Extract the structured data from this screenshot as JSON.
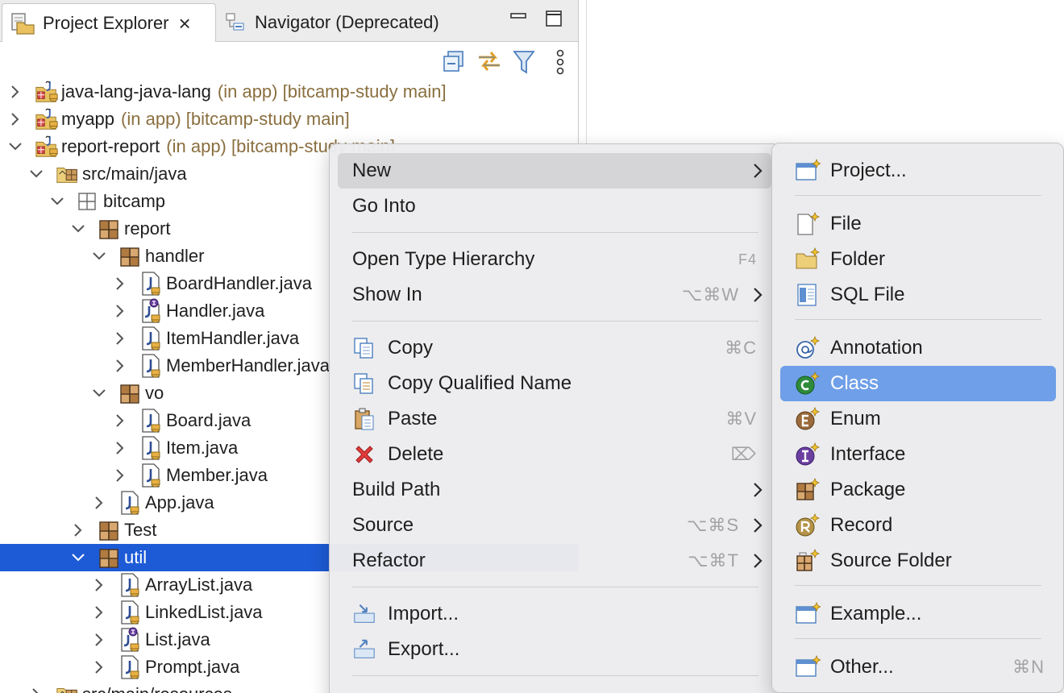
{
  "tabs": {
    "active": {
      "label": "Project Explorer",
      "icon": "project-explorer-icon"
    },
    "inactive": {
      "label": "Navigator (Deprecated)",
      "icon": "navigator-icon"
    },
    "close_glyph": "×"
  },
  "toolbar": {
    "buttons": [
      "collapse-all-icon",
      "link-with-editor-icon",
      "filter-icon",
      "view-menu-icon"
    ]
  },
  "tree": {
    "rows": [
      {
        "label": "java-lang-java-lang",
        "decoration": "(in app) [bitcamp-study main]",
        "icon": "java-project-icon",
        "expanded": false
      },
      {
        "label": "myapp",
        "decoration": "(in app) [bitcamp-study main]",
        "icon": "java-project-icon",
        "expanded": false
      },
      {
        "label": "report-report",
        "decoration": "(in app) [bitcamp-study main]",
        "icon": "java-project-icon",
        "expanded": true
      },
      {
        "label": "src/main/java",
        "icon": "source-folder-icon",
        "expanded": true
      },
      {
        "label": "bitcamp",
        "icon": "empty-package-icon",
        "expanded": true
      },
      {
        "label": "report",
        "icon": "package-icon",
        "expanded": true
      },
      {
        "label": "handler",
        "icon": "package-icon",
        "expanded": true
      },
      {
        "label": "BoardHandler.java",
        "icon": "java-file-icon",
        "expanded": false
      },
      {
        "label": "Handler.java",
        "icon": "java-interface-file-icon",
        "expanded": false
      },
      {
        "label": "ItemHandler.java",
        "icon": "java-file-icon",
        "expanded": false
      },
      {
        "label": "MemberHandler.java",
        "icon": "java-file-icon",
        "expanded": false
      },
      {
        "label": "vo",
        "icon": "package-icon",
        "expanded": true
      },
      {
        "label": "Board.java",
        "icon": "java-file-icon",
        "expanded": false
      },
      {
        "label": "Item.java",
        "icon": "java-file-icon",
        "expanded": false
      },
      {
        "label": "Member.java",
        "icon": "java-file-icon",
        "expanded": false
      },
      {
        "label": "App.java",
        "icon": "java-file-icon",
        "expanded": false
      },
      {
        "label": "Test",
        "icon": "package-icon",
        "expanded": false
      },
      {
        "label": "util",
        "icon": "package-icon",
        "expanded": true,
        "selected": true
      },
      {
        "label": "ArrayList.java",
        "icon": "java-file-icon",
        "expanded": false
      },
      {
        "label": "LinkedList.java",
        "icon": "java-file-icon",
        "expanded": false
      },
      {
        "label": "List.java",
        "icon": "java-interface-file-icon",
        "expanded": false
      },
      {
        "label": "Prompt.java",
        "icon": "java-file-icon",
        "expanded": false
      },
      {
        "label": "src/main/resources",
        "icon": "source-folder-icon",
        "expanded": false
      }
    ]
  },
  "context_menu": {
    "items": [
      {
        "label": "New",
        "submenu": true,
        "highlighted": true
      },
      {
        "label": "Go Into"
      },
      {
        "label": "Open Type Hierarchy",
        "shortcut": "F4"
      },
      {
        "label": "Show In",
        "shortcut": "⌥⌘W",
        "submenu": true
      },
      {
        "label": "Copy",
        "shortcut": "⌘C",
        "icon": "copy-icon"
      },
      {
        "label": "Copy Qualified Name",
        "icon": "copy-qualified-name-icon"
      },
      {
        "label": "Paste",
        "shortcut": "⌘V",
        "icon": "paste-icon"
      },
      {
        "label": "Delete",
        "shortcut": "⌦",
        "icon": "delete-icon"
      },
      {
        "label": "Build Path",
        "submenu": true
      },
      {
        "label": "Source",
        "shortcut": "⌥⌘S",
        "submenu": true
      },
      {
        "label": "Refactor",
        "shortcut": "⌥⌘T",
        "submenu": true
      },
      {
        "label": "Import...",
        "icon": "import-icon"
      },
      {
        "label": "Export...",
        "icon": "export-icon"
      }
    ]
  },
  "new_submenu": {
    "items": [
      {
        "label": "Project...",
        "icon": "new-project-icon"
      },
      {
        "label": "File",
        "icon": "new-file-icon"
      },
      {
        "label": "Folder",
        "icon": "new-folder-icon"
      },
      {
        "label": "SQL File",
        "icon": "new-sql-file-icon"
      },
      {
        "label": "Annotation",
        "icon": "new-annotation-icon"
      },
      {
        "label": "Class",
        "icon": "new-class-icon",
        "selected": true
      },
      {
        "label": "Enum",
        "icon": "new-enum-icon"
      },
      {
        "label": "Interface",
        "icon": "new-interface-icon"
      },
      {
        "label": "Package",
        "icon": "new-package-icon"
      },
      {
        "label": "Record",
        "icon": "new-record-icon"
      },
      {
        "label": "Source Folder",
        "icon": "new-source-folder-icon"
      },
      {
        "label": "Example...",
        "icon": "new-example-icon"
      },
      {
        "label": "Other...",
        "shortcut": "⌘N",
        "icon": "new-other-icon"
      }
    ]
  },
  "colors": {
    "selection": "#1d5bd6",
    "menu_selection": "#6f9fe8",
    "decoration": "#8a6f3f"
  }
}
